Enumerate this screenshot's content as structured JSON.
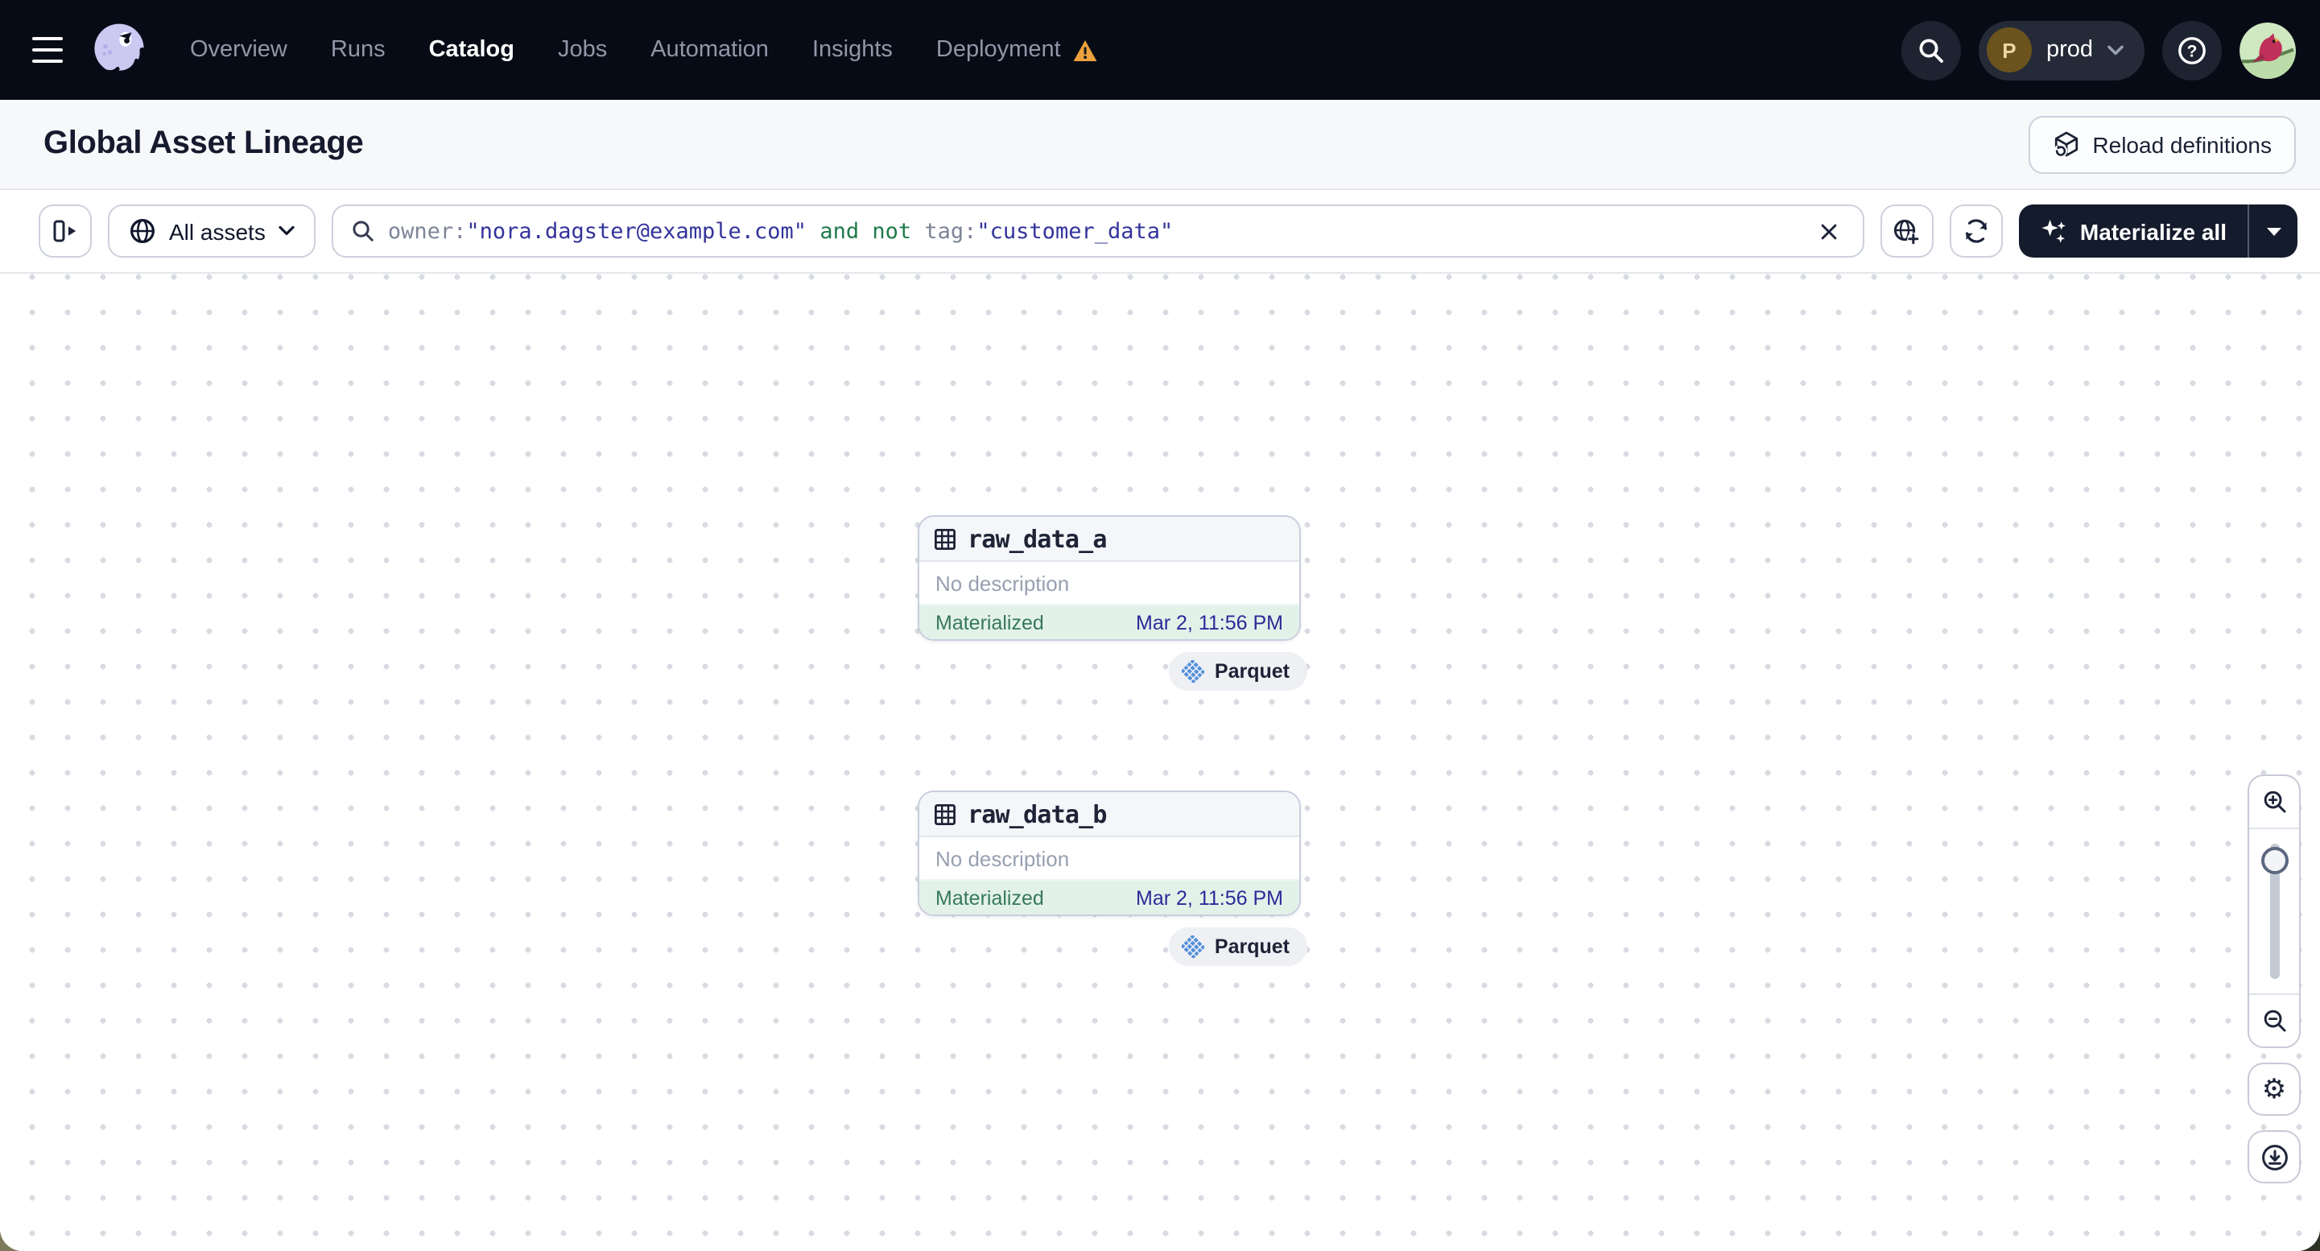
{
  "topnav": {
    "items": [
      {
        "label": "Overview",
        "active": false
      },
      {
        "label": "Runs",
        "active": false
      },
      {
        "label": "Catalog",
        "active": true
      },
      {
        "label": "Jobs",
        "active": false
      },
      {
        "label": "Automation",
        "active": false
      },
      {
        "label": "Insights",
        "active": false
      },
      {
        "label": "Deployment",
        "active": false,
        "warning": true
      }
    ],
    "deployment_switcher": {
      "initial": "P",
      "name": "prod"
    }
  },
  "header": {
    "title": "Global Asset Lineage",
    "reload_label": "Reload definitions"
  },
  "toolbar": {
    "scope_label": "All assets",
    "query": [
      {
        "text": "owner:",
        "role": "key"
      },
      {
        "text": "\"nora.dagster@example.com\"",
        "role": "value"
      },
      {
        "text": " and not ",
        "role": "operator"
      },
      {
        "text": "tag:",
        "role": "key"
      },
      {
        "text": "\"customer_data\"",
        "role": "value"
      }
    ],
    "materialize_label": "Materialize all"
  },
  "graph": {
    "nodes": [
      {
        "name": "raw_data_a",
        "description": "No description",
        "status": "Materialized",
        "timestamp": "Mar 2, 11:56 PM",
        "tag": "Parquet"
      },
      {
        "name": "raw_data_b",
        "description": "No description",
        "status": "Materialized",
        "timestamp": "Mar 2, 11:56 PM",
        "tag": "Parquet"
      }
    ]
  },
  "icons": {
    "gear_glyph": "⚙"
  },
  "colors": {
    "nav_bg": "#070b16",
    "accent_button": "#141b2c",
    "status_green": "#37795a",
    "status_bg": "#e3f2e9",
    "timestamp_navy": "#2b2b99",
    "query_value_indigo": "#33339c",
    "query_operator_green": "#1f7b4b",
    "query_key_gray": "#7d8597",
    "warning_orange": "#eda13c",
    "parquet_blue": "#5590d9",
    "logo_lavender": "#cbc8f2"
  }
}
